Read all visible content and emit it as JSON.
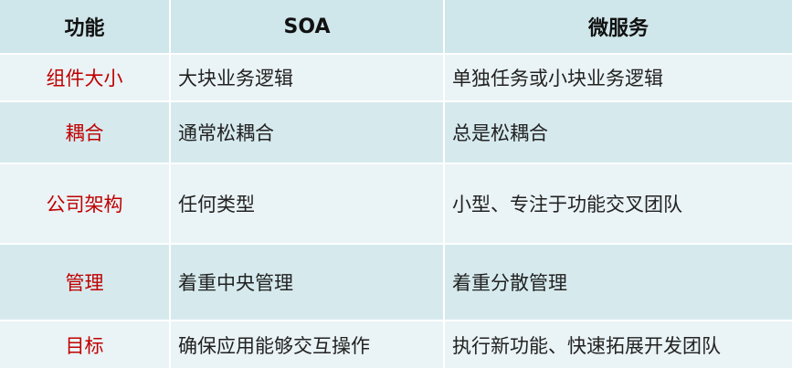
{
  "table": {
    "headers": [
      "功能",
      "SOA",
      "微服务"
    ],
    "rows": [
      {
        "feature": "组件大小",
        "soa": "大块业务逻辑",
        "micro": "单独任务或小块业务逻辑"
      },
      {
        "feature": "耦合",
        "soa": "通常松耦合",
        "micro": "总是松耦合"
      },
      {
        "feature": "公司架构",
        "soa": "任何类型",
        "micro": "小型、专注于功能交叉团队"
      },
      {
        "feature": "管理",
        "soa": "着重中央管理",
        "micro": "着重分散管理"
      },
      {
        "feature": "目标",
        "soa": "确保应用能够交互操作",
        "micro": "执行新功能、快速拓展开发团队"
      }
    ]
  },
  "colors": {
    "header_bg": "#cfe6ea",
    "row_light": "#eaf3f5",
    "row_dark": "#d6eaee",
    "feature_text": "#c00000"
  }
}
